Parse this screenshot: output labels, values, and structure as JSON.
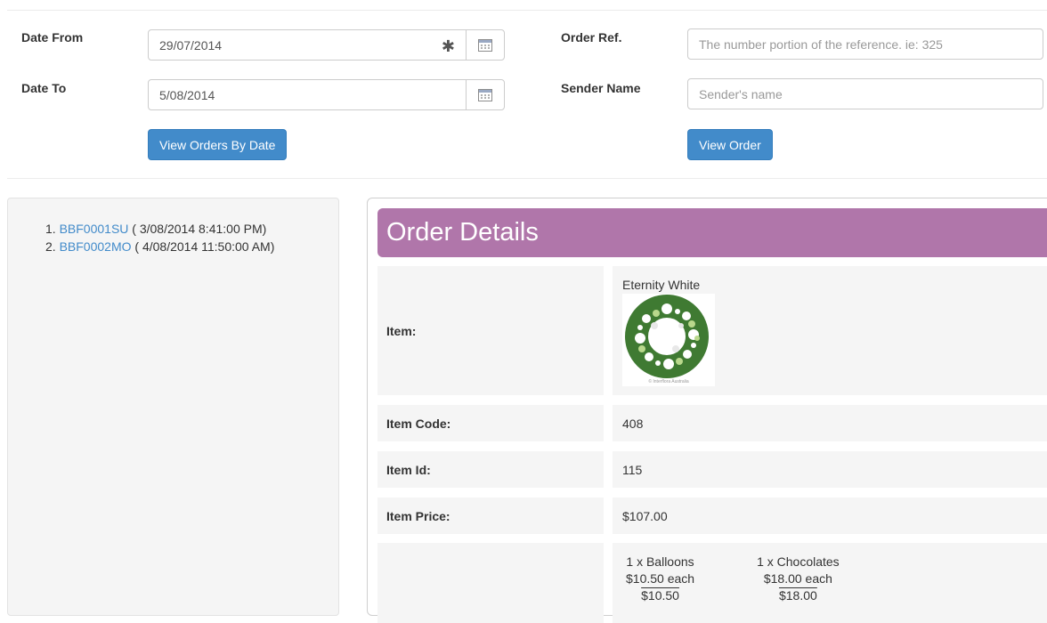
{
  "filter": {
    "date_from_label": "Date From",
    "date_from_value": "29/07/2014",
    "date_to_label": "Date To",
    "date_to_value": "5/08/2014",
    "required_marker": "✱",
    "view_by_date_button": "View Orders By Date",
    "order_ref_label": "Order Ref.",
    "order_ref_placeholder": "The number portion of the reference. ie: 325",
    "sender_name_label": "Sender Name",
    "sender_name_placeholder": "Sender's name",
    "view_order_button": "View Order"
  },
  "orders": [
    {
      "number": "1.",
      "ref": "BBF0001SU",
      "date": "( 3/08/2014 8:41:00 PM)"
    },
    {
      "number": "2.",
      "ref": "BBF0002MO",
      "date": "( 4/08/2014 11:50:00 AM)"
    }
  ],
  "details": {
    "title": "Order Details",
    "item_label": "Item:",
    "item_name": "Eternity White",
    "image_caption": "© Interflora Australia",
    "item_code_label": "Item Code:",
    "item_code": "408",
    "item_id_label": "Item Id:",
    "item_id": "115",
    "item_price_label": "Item Price:",
    "item_price": "$107.00",
    "extras": [
      {
        "qty": "1 x Balloons",
        "each": "$10.50 each",
        "total": "$10.50"
      },
      {
        "qty": "1 x Chocolates",
        "each": "$18.00 each",
        "total": "$18.00"
      }
    ]
  },
  "colors": {
    "primary_button": "#428bca",
    "link": "#428bca",
    "banner": "#b076aa"
  },
  "icons": {
    "calendar": "calendar-icon",
    "required": "asterisk-icon"
  }
}
